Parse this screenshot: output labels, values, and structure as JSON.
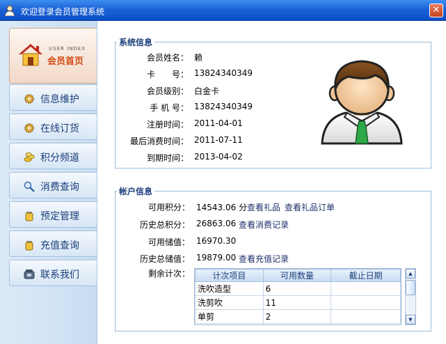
{
  "window": {
    "title": "欢迎登录会员管理系统",
    "close_label": "✕"
  },
  "sidebar": {
    "home": {
      "sub": "USER INDEX",
      "label": "会员首页"
    },
    "items": [
      {
        "label": "信息维护",
        "icon": "gear-icon"
      },
      {
        "label": "在线订货",
        "icon": "gear-icon"
      },
      {
        "label": "积分频道",
        "icon": "coins-icon"
      },
      {
        "label": "消费查询",
        "icon": "magnifier-icon"
      },
      {
        "label": "预定管理",
        "icon": "jar-icon"
      },
      {
        "label": "充值查询",
        "icon": "jar-icon"
      },
      {
        "label": "联系我们",
        "icon": "phone-icon"
      }
    ]
  },
  "system_info": {
    "legend": "系统信息",
    "fields": [
      {
        "label": "会员姓名：",
        "value": "赖"
      },
      {
        "label": "卡　　号：",
        "value": "13824340349"
      },
      {
        "label": "会员级别：",
        "value": "白金卡"
      },
      {
        "label": "手 机 号：",
        "value": "13824340349"
      },
      {
        "label": "注册时间：",
        "value": "2011-04-01"
      },
      {
        "label": "最后消费时间：",
        "value": "2011-07-11"
      },
      {
        "label": "到期时间：",
        "value": "2013-04-02"
      }
    ]
  },
  "account_info": {
    "legend": "帐户信息",
    "available_points": {
      "label": "可用积分：",
      "value": "14543.06 分",
      "link1": "查看礼品",
      "link2": "查看礼品订单"
    },
    "total_points": {
      "label": "历史总积分：",
      "value": "26863.06",
      "link": "查看消费记录"
    },
    "available_balance": {
      "label": "可用储值：",
      "value": "16970.30"
    },
    "total_stored": {
      "label": "历史总储值：",
      "value": "19879.00",
      "link": "查看充值记录"
    },
    "count_label": "剩余计次：",
    "table": {
      "headers": [
        "计次项目",
        "可用数量",
        "截止日期"
      ],
      "rows": [
        [
          "洗吹造型",
          "6",
          ""
        ],
        [
          "洗剪吹",
          "11",
          ""
        ],
        [
          "单剪",
          "2",
          ""
        ]
      ]
    }
  },
  "colors": {
    "titlebar": "#1c63d8",
    "home_label": "#d34b12",
    "legend": "#1b3f7c"
  }
}
